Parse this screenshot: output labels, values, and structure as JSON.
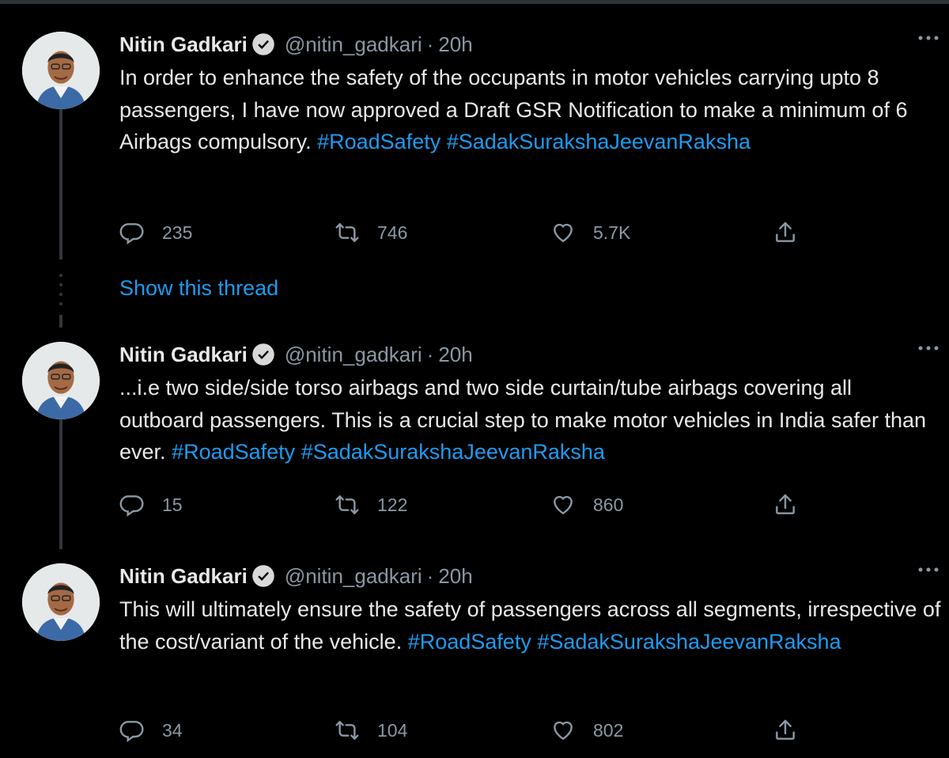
{
  "author": {
    "name": "Nitin Gadkari",
    "handle": "@nitin_gadkari",
    "separator": "·",
    "verified": true
  },
  "icons": {
    "verified": "verified-badge-icon",
    "more": "more-options-icon",
    "reply": "reply-icon",
    "retweet": "retweet-icon",
    "like": "heart-icon",
    "share": "share-icon"
  },
  "colors": {
    "background": "#000000",
    "text": "#e7e9ea",
    "secondary_text": "#8b98a5",
    "link": "#1d9bf0",
    "thread_line": "#333639"
  },
  "tweets": [
    {
      "time": "20h",
      "text": "In order to enhance the safety of the occupants in motor vehicles carrying upto 8 passengers, I have now approved a Draft GSR Notification to make a minimum of 6 Airbags compulsory.",
      "hashtags": [
        "#RoadSafety",
        "#SadakSurakshaJeevanRaksha"
      ],
      "replies": "235",
      "retweets": "746",
      "likes": "5.7K"
    },
    {
      "time": "20h",
      "text": "...i.e two side/side torso airbags and two side curtain/tube airbags covering all outboard passengers. This is a crucial step to make motor vehicles in India safer than ever.",
      "hashtags": [
        "#RoadSafety",
        "#SadakSurakshaJeevanRaksha"
      ],
      "replies": "15",
      "retweets": "122",
      "likes": "860"
    },
    {
      "time": "20h",
      "text": "This will ultimately ensure the safety of passengers across all segments, irrespective of the cost/variant of the vehicle.",
      "hashtags": [
        "#RoadSafety",
        "#SadakSurakshaJeevanRaksha"
      ],
      "replies": "34",
      "retweets": "104",
      "likes": "802"
    }
  ],
  "show_thread": "Show this thread"
}
